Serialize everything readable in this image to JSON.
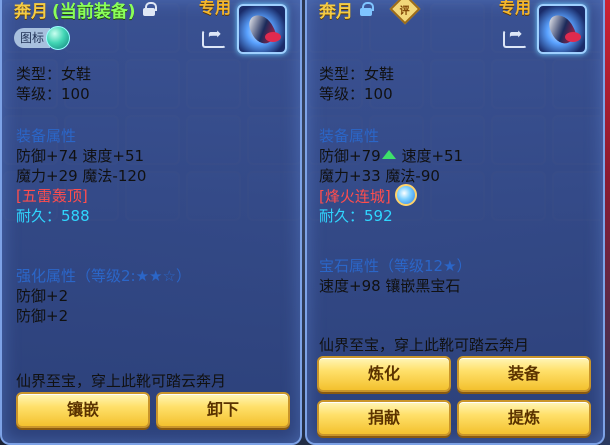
{
  "left_panel": {
    "title_name": "奔月",
    "title_status": "(当前装备)",
    "exclusive_label": "专用",
    "badge_label": "图标",
    "type_line": "类型：女鞋",
    "level_line": "等级：100",
    "equip_attr_head": "装备属性",
    "attr_line_1": "防御+74 速度+51",
    "attr_line_2": "魔力+29 魔法-120",
    "special_effect": "[五雷轰顶]",
    "durability": "耐久：588",
    "enhance_head": "强化属性（等级2:★★☆）",
    "enhance_line_1": "防御+2",
    "enhance_line_2": "防御+2",
    "flavor": "仙界至宝，穿上此靴可踏云奔月",
    "buttons": {
      "inlay": "镶嵌",
      "unequip": "卸下"
    }
  },
  "right_panel": {
    "title_name": "奔月",
    "exclusive_label": "专用",
    "seal_label": "评",
    "type_line": "类型：女鞋",
    "level_line": "等级：100",
    "equip_attr_head": "装备属性",
    "attr_line_1a": "防御+79",
    "attr_line_1b": "速度+51",
    "attr_line_2": "魔力+33 魔法-90",
    "special_effect": "[烽火连城]",
    "durability": "耐久：592",
    "gem_head": "宝石属性（等级12★）",
    "gem_line": "速度+98 镶嵌黑宝石",
    "flavor": "仙界至宝，穿上此靴可踏云奔月",
    "buttons": {
      "refine": "炼化",
      "equip": "装备",
      "donate": "捐献",
      "extract": "提炼"
    }
  }
}
